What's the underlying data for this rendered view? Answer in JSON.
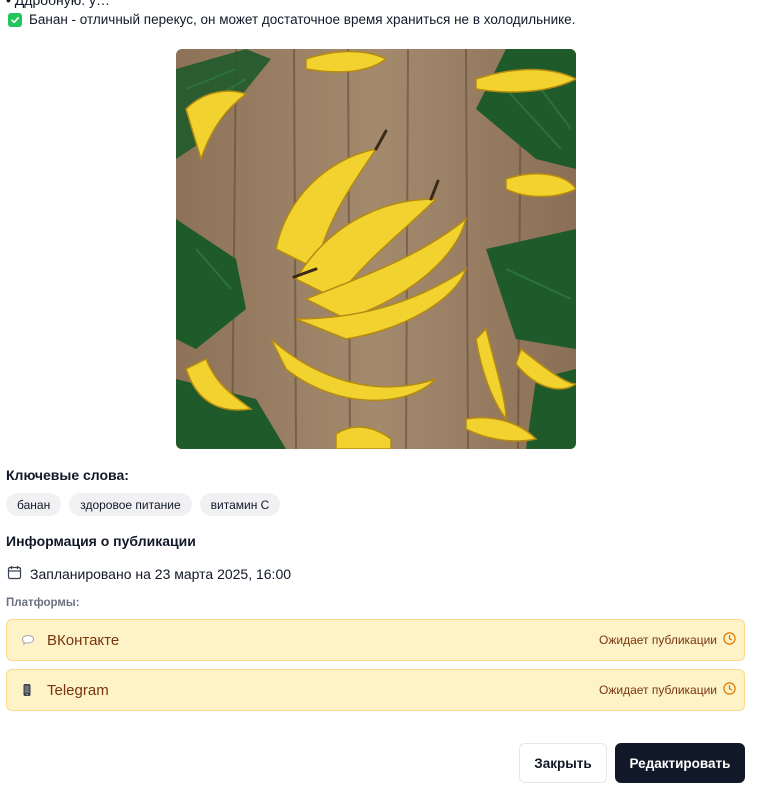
{
  "top": {
    "clipped_text": "• Ддробную. у…",
    "checklist_item": "Банан - отличный перекус, он может достаточное время храниться не в холодильнике."
  },
  "image": {
    "alt": "Бананы на деревянном столе с пальмовыми листьями"
  },
  "keywords": {
    "title": "Ключевые слова:",
    "items": [
      "банан",
      "здоровое питание",
      "витамин С"
    ]
  },
  "publication": {
    "title": "Информация о публикации",
    "scheduled": "Запланировано на 23 марта 2025, 16:00",
    "platforms_label": "Платформы:",
    "platforms": [
      {
        "name": "ВКонтакте",
        "status": "Ожидает публикации",
        "icon": "speech-bubble-icon"
      },
      {
        "name": "Telegram",
        "status": "Ожидает публикации",
        "icon": "phone-icon"
      }
    ]
  },
  "footer": {
    "close_label": "Закрыть",
    "edit_label": "Редактировать"
  },
  "colors": {
    "accent": "#111827",
    "pending_bg": "#fef3c7",
    "pending_border": "#fcd98c",
    "pending_text": "#78350f",
    "check_green": "#22c55e"
  }
}
